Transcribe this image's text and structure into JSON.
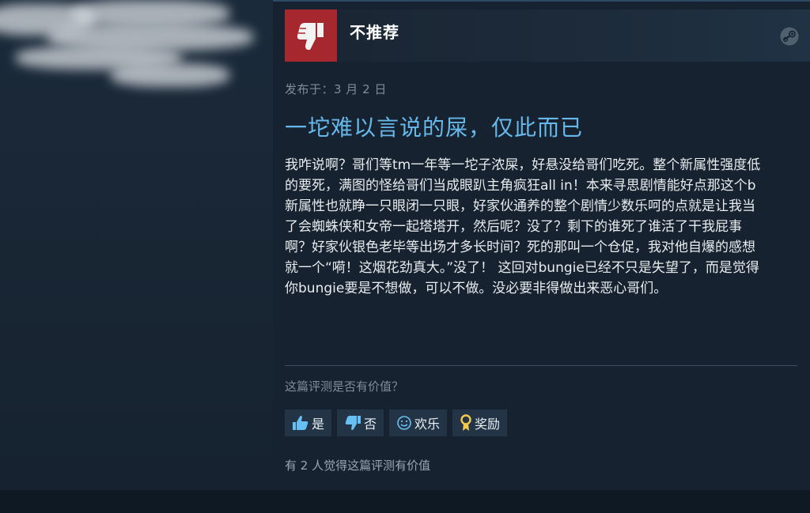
{
  "review": {
    "verdict": "不推荐",
    "posted": "发布于：3 月 2 日",
    "title": "一坨难以言说的屎，仅此而已",
    "body": "我咋说啊？哥们等tm一年等一坨子浓屎，好悬没给哥们吃死。整个新属性强度低的要死，满图的怪给哥们当成眼趴主角疯狂all in！本来寻思剧情能好点那这个b新属性也就睁一只眼闭一只眼，好家伙通养的整个剧情少数乐呵的点就是让我当了会蜘蛛侠和女帝一起塔塔开，然后呢？没了？剩下的谁死了谁活了干我屁事啊？好家伙银色老毕等出场才多长时间？死的那叫一个仓促，我对他自爆的感想就一个“嗬！这烟花劲真大。”没了！ 这回对bungie已经不只是失望了，而是觉得你bungie要是不想做，可以不做。没必要非得做出来恶心哥们。"
  },
  "feedback": {
    "question": "这篇评测是否有价值？",
    "buttons": {
      "yes": "是",
      "no": "否",
      "funny": "欢乐",
      "award": "奖励"
    },
    "count_text": "有 2 人觉得这篇评测有价值"
  },
  "icons": {
    "verdict": "thumbs-down-icon",
    "brand": "steam-logo-icon",
    "yes": "thumbs-up-icon",
    "no": "thumbs-down-icon",
    "funny": "smiley-icon",
    "award": "award-ribbon-icon"
  },
  "colors": {
    "background": "#16222f",
    "thumb_box": "#a7272e",
    "title": "#67b8ea",
    "button_bg": "#243447"
  }
}
